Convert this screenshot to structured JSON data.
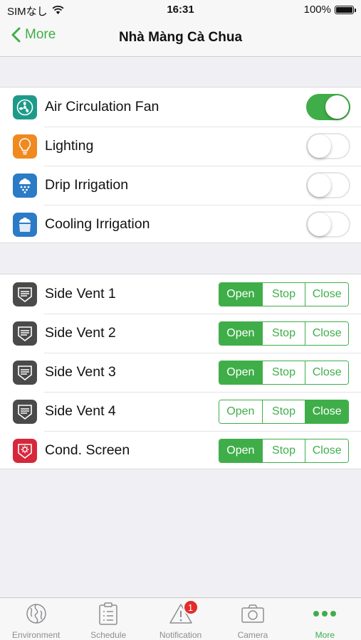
{
  "status_bar": {
    "carrier": "SIMなし",
    "time": "16:31",
    "battery": "100%"
  },
  "nav": {
    "back_label": "More",
    "title": "Nhà Màng Cà Chua"
  },
  "devices": [
    {
      "label": "Air Circulation Fan",
      "icon": "fan-icon",
      "on": true
    },
    {
      "label": "Lighting",
      "icon": "lightbulb-icon",
      "on": false
    },
    {
      "label": "Drip Irrigation",
      "icon": "drip-irrigation-icon",
      "on": false
    },
    {
      "label": "Cooling Irrigation",
      "icon": "cooling-irrigation-icon",
      "on": false
    }
  ],
  "vents": [
    {
      "label": "Side Vent 1",
      "icon": "vent-icon",
      "state": "Open"
    },
    {
      "label": "Side Vent 2",
      "icon": "vent-icon",
      "state": "Open"
    },
    {
      "label": "Side Vent 3",
      "icon": "vent-icon",
      "state": "Open"
    },
    {
      "label": "Side Vent 4",
      "icon": "vent-icon",
      "state": "Close"
    },
    {
      "label": "Cond. Screen",
      "icon": "screen-icon",
      "state": "Open"
    }
  ],
  "segment_labels": {
    "open": "Open",
    "stop": "Stop",
    "close": "Close"
  },
  "tabs": [
    {
      "label": "Environment",
      "icon": "environment-icon",
      "active": false
    },
    {
      "label": "Schedule",
      "icon": "schedule-icon",
      "active": false
    },
    {
      "label": "Notification",
      "icon": "notification-icon",
      "active": false,
      "badge": "1"
    },
    {
      "label": "Camera",
      "icon": "camera-icon",
      "active": false
    },
    {
      "label": "More",
      "icon": "more-icon",
      "active": true
    }
  ],
  "colors": {
    "accent": "#3fae49",
    "fan_icon_bg": "#1e9a8a",
    "lighting_icon_bg": "#f0891e",
    "irrigation_icon_bg": "#2b7bc6",
    "vent_icon_bg": "#4a4a4a",
    "screen_icon_bg": "#d6283b",
    "badge": "#e32b2b"
  }
}
